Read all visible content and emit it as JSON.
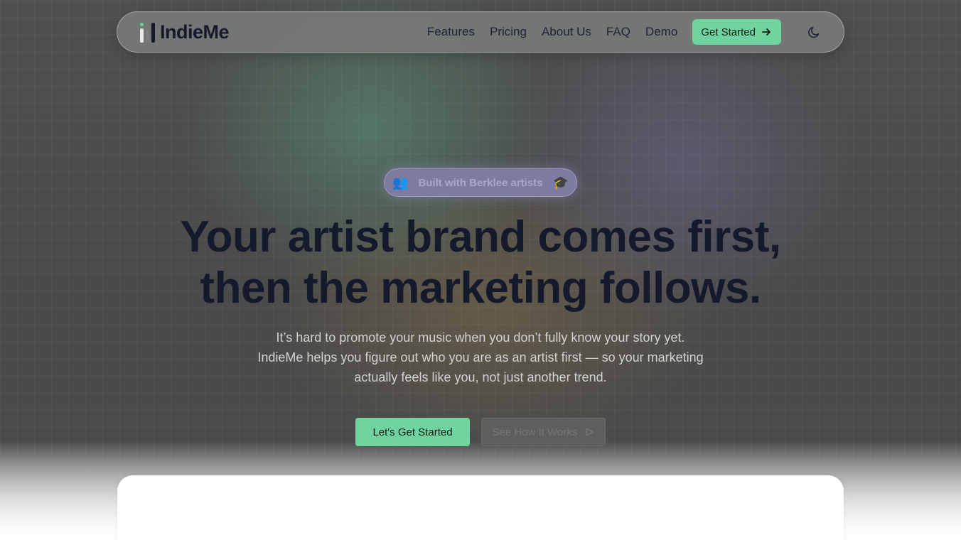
{
  "nav": {
    "logo_text": "IndieMe",
    "links": [
      "Features",
      "Pricing",
      "About Us",
      "FAQ",
      "Demo"
    ],
    "cta_label": "Get Started",
    "theme_toggle_icon": "moon-icon"
  },
  "hero": {
    "badge_text": "Built with Berklee artists",
    "badge_left_icon": "👥",
    "badge_right_icon": "🎓",
    "headline_line1": "Your artist brand comes first,",
    "headline_line2": "then the marketing follows.",
    "sub_line1": "It’s hard to promote your music when you don’t fully know your story yet.",
    "sub_line2": "IndieMe helps you figure out who you are as an artist first — so your marketing",
    "sub_line3": "actually feels like you, not just another trend.",
    "primary_button": "Let's Get Started",
    "secondary_button": "See How It Works"
  },
  "colors": {
    "accent": "#6fd49f",
    "text_dark": "#141a2c",
    "badge_bg": "#7e7ba1"
  }
}
